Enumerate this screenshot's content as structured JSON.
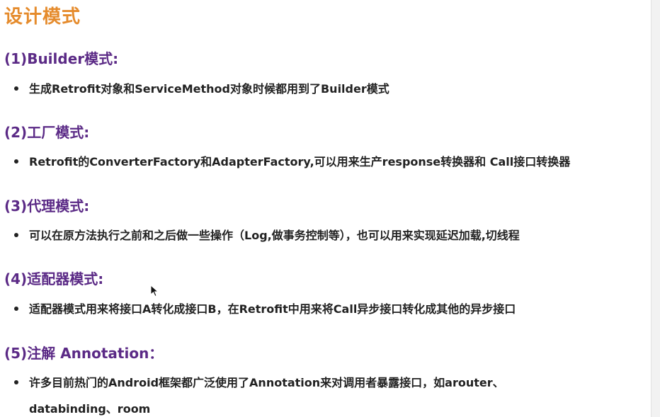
{
  "title": "设计模式",
  "sections": [
    {
      "heading": "(1)Builder模式:",
      "bullet": "生成Retrofit对象和ServiceMethod对象时候都用到了Builder模式"
    },
    {
      "heading": "(2)工厂模式:",
      "bullet": "Retrofit的ConverterFactory和AdapterFactory,可以用来生产response转换器和 Call接口转换器"
    },
    {
      "heading": "(3)代理模式:",
      "bullet": "可以在原方法执行之前和之后做一些操作（Log,做事务控制等），也可以用来实现延迟加载,切线程"
    },
    {
      "heading": "(4)适配器模式:",
      "bullet": "适配器模式用来将接口A转化成接口B，在Retrofit中用来将Call异步接口转化成其他的异步接口"
    },
    {
      "heading": "(5)注解 Annotation：",
      "bullet": "许多目前热门的Android框架都广泛使用了Annotation来对调用者暴露接口，如arouter、",
      "bullet_continuation": "databinding、room"
    }
  ]
}
